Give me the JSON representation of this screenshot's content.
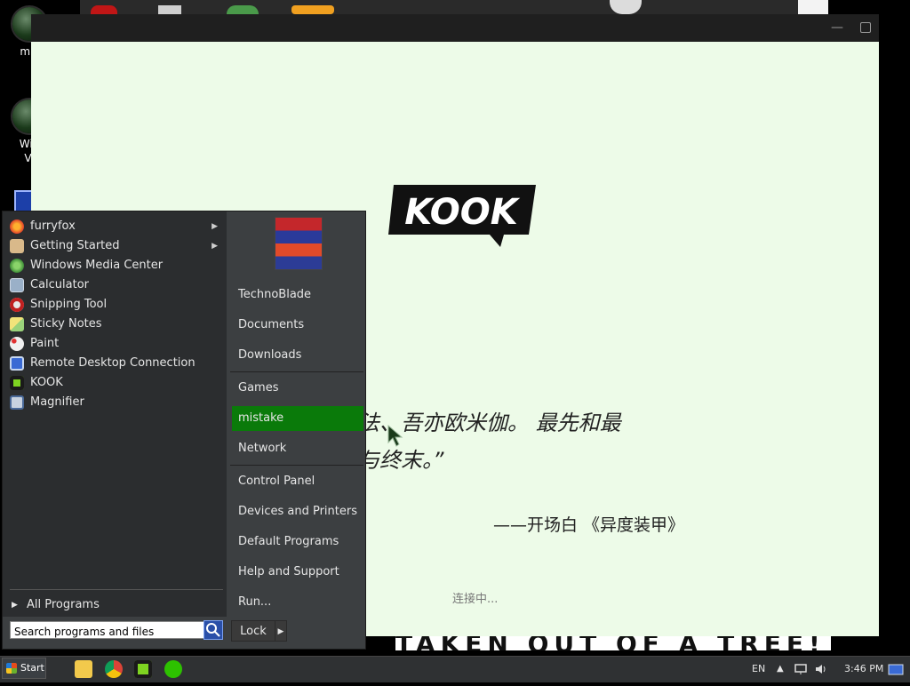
{
  "desktop": {
    "icons": [
      {
        "label": "mis"
      },
      {
        "label": "Win\nVi"
      }
    ]
  },
  "kook_window": {
    "quote_line1": "法、吾亦欧米伽。 最先和最",
    "quote_line2": "与终末。”",
    "source": "——开场白 《异度装甲》",
    "status": "连接中...",
    "bottom_banner": "TAKEN OUT OF A TREE!",
    "logo_text": "KOOK"
  },
  "start_menu": {
    "programs": [
      {
        "label": "furryfox",
        "icon": "firefox-icon",
        "has_submenu": true
      },
      {
        "label": "Getting Started",
        "icon": "getting-started-icon",
        "has_submenu": true
      },
      {
        "label": "Windows Media Center",
        "icon": "media-center-icon",
        "has_submenu": false
      },
      {
        "label": "Calculator",
        "icon": "calculator-icon",
        "has_submenu": false
      },
      {
        "label": "Snipping Tool",
        "icon": "snipping-tool-icon",
        "has_submenu": false
      },
      {
        "label": "Sticky Notes",
        "icon": "sticky-notes-icon",
        "has_submenu": false
      },
      {
        "label": "Paint",
        "icon": "paint-icon",
        "has_submenu": false
      },
      {
        "label": "Remote Desktop Connection",
        "icon": "remote-desktop-icon",
        "has_submenu": false
      },
      {
        "label": "KOOK",
        "icon": "kook-icon",
        "has_submenu": false
      },
      {
        "label": "Magnifier",
        "icon": "magnifier-icon",
        "has_submenu": false
      }
    ],
    "all_programs": "All Programs",
    "search_placeholder": "Search programs and files",
    "right_items": [
      {
        "label": "TechnoBlade"
      },
      {
        "label": "Documents"
      },
      {
        "label": "Downloads"
      },
      {
        "label": "Games"
      },
      {
        "label": "mistake"
      },
      {
        "label": "Network"
      },
      {
        "label": "Control Panel"
      },
      {
        "label": "Devices and Printers"
      },
      {
        "label": "Default Programs"
      },
      {
        "label": "Help and Support"
      },
      {
        "label": "Run..."
      }
    ],
    "lock_label": "Lock"
  },
  "taskbar": {
    "start_label": "Start",
    "language": "EN",
    "clock": "3:46 PM"
  },
  "colors": {
    "kook_bg": "#edfbe8",
    "menu_bg": "#2b2d2f",
    "highlight": "#0a7a0a"
  }
}
